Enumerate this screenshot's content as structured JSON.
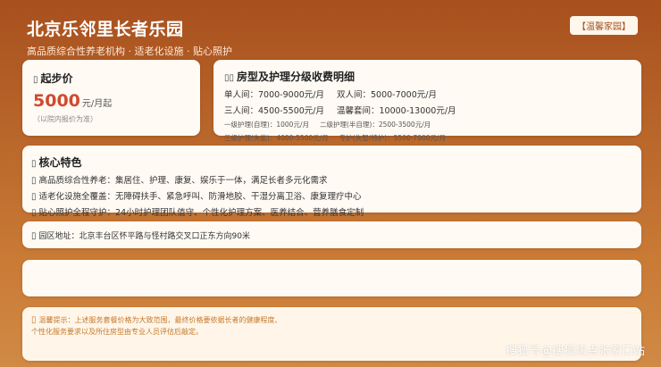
{
  "header": {
    "title": "北京乐邻里长者乐园",
    "subtitle": "高品质综合性养老机构 · 适老化设施 · 贴心照护",
    "tag": "【温馨家园】"
  },
  "price": {
    "heading": "起步价",
    "amount": "5000",
    "unit": "元/月起",
    "note": "（以院内报价为准）"
  },
  "fees": {
    "heading": "房型及护理分级收费明细",
    "rows": [
      [
        "单人间：7000-9000元/月",
        "双人间：5000-7000元/月"
      ],
      [
        "三人间：4500-5500元/月",
        "温馨套间：10000-13000元/月"
      ]
    ],
    "care_rows": [
      [
        "一级护理(自理)：1000元/月",
        "二级护理(半自理)：2500-3500元/月"
      ],
      [
        "三级护理(失能)：4000-5500元/月",
        "专护(失智/特护)：5500-7000元/月"
      ]
    ]
  },
  "features": {
    "heading": "核心特色",
    "items": [
      {
        "key": "高品质综合性养老：",
        "value": "集居住、护理、康复、娱乐于一体，满足长者多元化需求"
      },
      {
        "key": "适老化设施全覆盖：",
        "value": "无障碍扶手、紧急呼叫、防滑地胶、干湿分离卫浴、康复理疗中心"
      },
      {
        "key": "贴心照护全程守护：",
        "value": "24小时护理团队值守、个性化护理方案、医养结合、营养膳食定制"
      }
    ]
  },
  "address": {
    "label": "园区地址：",
    "value": "北京丰台区怀平路与怪村路交叉口正东方向90米"
  },
  "tip": {
    "line1": "温馨提示：上述服务套餐价格为大致范围，最终价格要依据长者的健康程度、",
    "line2": "个性化服务要求以及所住房型由专业人员评估后敲定。"
  },
  "watermark": "搜狐号@搜狐焦点张家口站"
}
